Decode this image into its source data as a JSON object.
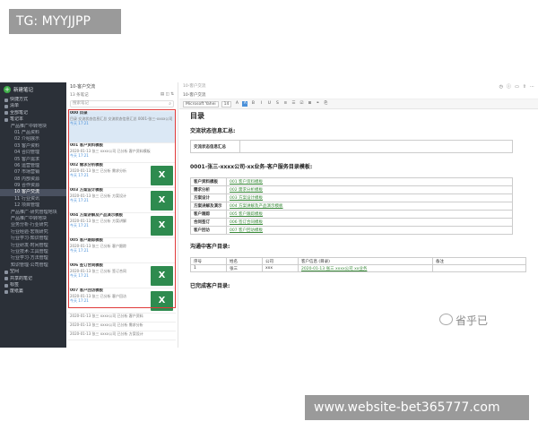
{
  "watermark_tag": "TG: MYYJJPP",
  "bottom_banner": "www.website-bet365777.com",
  "right_watermark": "省乎已",
  "sidebar": {
    "new_label": "新建笔记",
    "items": [
      {
        "label": "快捷方式",
        "level": 0
      },
      {
        "label": "清单",
        "level": 0
      },
      {
        "label": "全部笔记",
        "level": 0
      },
      {
        "label": "笔记本",
        "level": 0
      },
      {
        "label": "产品推广中转地块",
        "level": 1
      },
      {
        "label": "01 产品资料",
        "level": 2
      },
      {
        "label": "02 介绍展示",
        "level": 2
      },
      {
        "label": "03 客户资料",
        "level": 2
      },
      {
        "label": "04 合同管理",
        "level": 2
      },
      {
        "label": "05 客户需求",
        "level": 2
      },
      {
        "label": "06 运营管理",
        "level": 2
      },
      {
        "label": "07 市场营销",
        "level": 2
      },
      {
        "label": "08 内部资源",
        "level": 2
      },
      {
        "label": "09 合作资源",
        "level": 2
      },
      {
        "label": "10 客户交流",
        "level": 2,
        "active": true
      },
      {
        "label": "11 行业资讯",
        "level": 2
      },
      {
        "label": "12 项目管理",
        "level": 2
      },
      {
        "label": "产品推广·研究管理地块",
        "level": 1
      },
      {
        "label": "产品推广中转地块",
        "level": 1
      },
      {
        "label": "业务分析·行业研究",
        "level": 1
      },
      {
        "label": "行业经验·宏观研究",
        "level": 1
      },
      {
        "label": "行业学习·知识管理",
        "level": 1
      },
      {
        "label": "行业研发·时间管理",
        "level": 1
      },
      {
        "label": "行业技术·工具管理",
        "level": 1
      },
      {
        "label": "行业学习·方法管理",
        "level": 1
      },
      {
        "label": "知识管理·公司管理",
        "level": 1
      },
      {
        "label": "空间",
        "level": 0
      },
      {
        "label": "共享的笔记",
        "level": 0
      },
      {
        "label": "标签",
        "level": 0
      },
      {
        "label": "废纸篓",
        "level": 0
      }
    ]
  },
  "list": {
    "title": "10-客户交流",
    "count": "13 条笔记",
    "search_placeholder": "搜索笔记",
    "notes": [
      {
        "title": "000 目录",
        "snippet": "目录 交流状态信息汇总 交流状态信息汇总 0001-张三-xxxx公司",
        "date": "今天 17:21",
        "selected": true,
        "excel": false
      },
      {
        "title": "001 客户资料模板",
        "snippet": "2020-01-13 张三 xxxx公司 已分析 客户资料模板",
        "date": "今天 17:21",
        "excel": false
      },
      {
        "title": "002 需求分析模板",
        "snippet": "2020-01-13 张三 已分析 需求分析",
        "date": "今天 17:21",
        "excel": true
      },
      {
        "title": "003 方案设计模板",
        "snippet": "2020-01-13 张三 已分析 方案设计",
        "date": "今天 17:21",
        "excel": true
      },
      {
        "title": "004 方案讲解及产品演示模板",
        "snippet": "2020-01-13 张三 已分析 方案讲解",
        "date": "今天 17:21",
        "excel": true
      },
      {
        "title": "005 客户跟踪模板",
        "snippet": "2020-01-13 张三 已分析 客户跟踪",
        "date": "今天 17:21",
        "excel": false
      },
      {
        "title": "006 签订合同模板",
        "snippet": "2020-01-13 张三 已分析 签订合同",
        "date": "今天 17:21",
        "excel": true
      },
      {
        "title": "007 客户回访模板",
        "snippet": "2020-01-13 张三 已分析 客户回访",
        "date": "今天 17:21",
        "excel": true
      },
      {
        "title": "",
        "snippet": "2020-01-13 张三 xxxx公司 已分析 客户资料",
        "date": "今天 17:21",
        "excel": false
      },
      {
        "title": "",
        "snippet": "2020-01-13 张三 xxxx公司 已分析 需求分析",
        "date": "今天 17:21",
        "excel": false
      },
      {
        "title": "",
        "snippet": "2020-01-13 张三 xxxx公司 已分析 方案设计",
        "date": "今天 17:21",
        "excel": false
      }
    ]
  },
  "editor": {
    "crumb": "10-客户交流",
    "tab": "10-客户交流",
    "font": "Microsoft Yahei",
    "size": "14",
    "heading": "目录",
    "section1": "交流状态信息汇总:",
    "box_label": "交流状态信息汇总",
    "section2": "0001-张三-xxxx公司-xx业务-客户服务目录模板:",
    "rows": [
      {
        "k": "客户资料模板",
        "v": "001 客户资料模板"
      },
      {
        "k": "需求分析",
        "v": "002 需求分析模板"
      },
      {
        "k": "方案设计",
        "v": "003 方案设计模板"
      },
      {
        "k": "方案讲解及演示",
        "v": "004 方案讲解及产品演示模板"
      },
      {
        "k": "客户跟踪",
        "v": "005 客户跟踪模板"
      },
      {
        "k": "合同签订",
        "v": "006 签订合同模板"
      },
      {
        "k": "客户回访",
        "v": "007 客户回访模板"
      }
    ],
    "section3": "沟通中客户目录:",
    "tbl_headers": [
      "序号",
      "姓名",
      "公司",
      "客户信息 (目录)",
      "备注"
    ],
    "tbl_row": [
      "1",
      "张三",
      "xxx",
      "2020-01-13 张三 xxxx公司 xx业务",
      ""
    ],
    "section4": "已完成客户目录:"
  }
}
